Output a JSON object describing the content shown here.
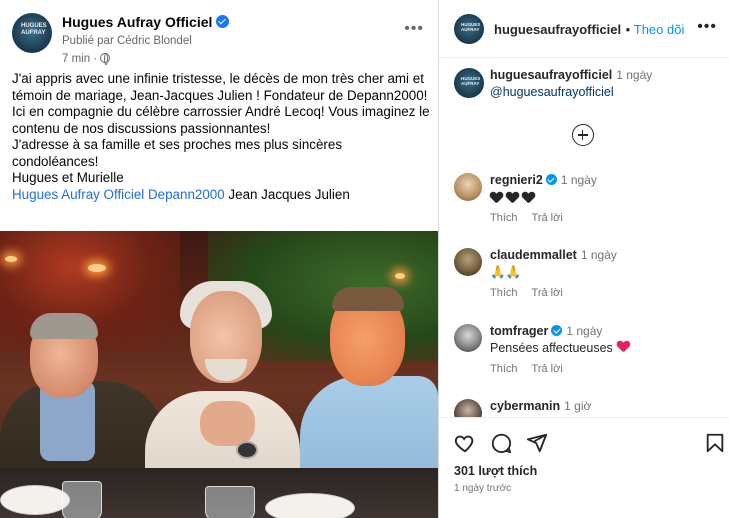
{
  "post": {
    "page_name": "Hugues Aufray Officiel",
    "published_by": "Publié par Cédric Blondel",
    "time": "7 min ·",
    "avatar_text": "HUGUES AUFRAY",
    "paragraphs": [
      "J'ai appris avec une infinie tristesse, le décès de mon très cher ami et témoin de mariage, Jean-Jacques Julien ! Fondateur de Depann2000! Ici en compagnie du célèbre carrossier André Lecoq! Vous imaginez le contenu de nos discussions passionnantes!",
      "J'adresse à sa famille et ses proches mes plus sincères condoléances!",
      "Hugues et Murielle"
    ],
    "tags": {
      "link1": "Hugues Aufray Officiel",
      "link2": "Depann2000",
      "plain": "Jean Jacques Julien"
    }
  },
  "instagram": {
    "header": {
      "username": "huguesaufrayofficiel",
      "follow_label": "Theo dõi"
    },
    "caption": {
      "username": "huguesaufrayofficiel",
      "time": "1 ngày",
      "mention": "@huguesaufrayofficiel"
    },
    "comments": [
      {
        "user": "regnieri2",
        "verified": true,
        "time": "1 ngày",
        "text": "",
        "hearts": 3,
        "like": "Thích",
        "reply": "Trả lời"
      },
      {
        "user": "claudemmallet",
        "verified": false,
        "time": "1 ngày",
        "text": "🙏🙏",
        "like": "Thích",
        "reply": "Trả lời"
      },
      {
        "user": "tomfrager",
        "verified": true,
        "time": "1 ngày",
        "text": "Pensées affectueuses",
        "like": "Thích",
        "reply": "Trả lời"
      },
      {
        "user": "cybermanin",
        "verified": false,
        "time": "1 giờ",
        "text": ""
      }
    ],
    "likes": "301 lượt thích",
    "date": "1 ngày trước",
    "icons": [
      "heart-icon",
      "comment-icon",
      "share-icon",
      "bookmark-icon"
    ]
  }
}
